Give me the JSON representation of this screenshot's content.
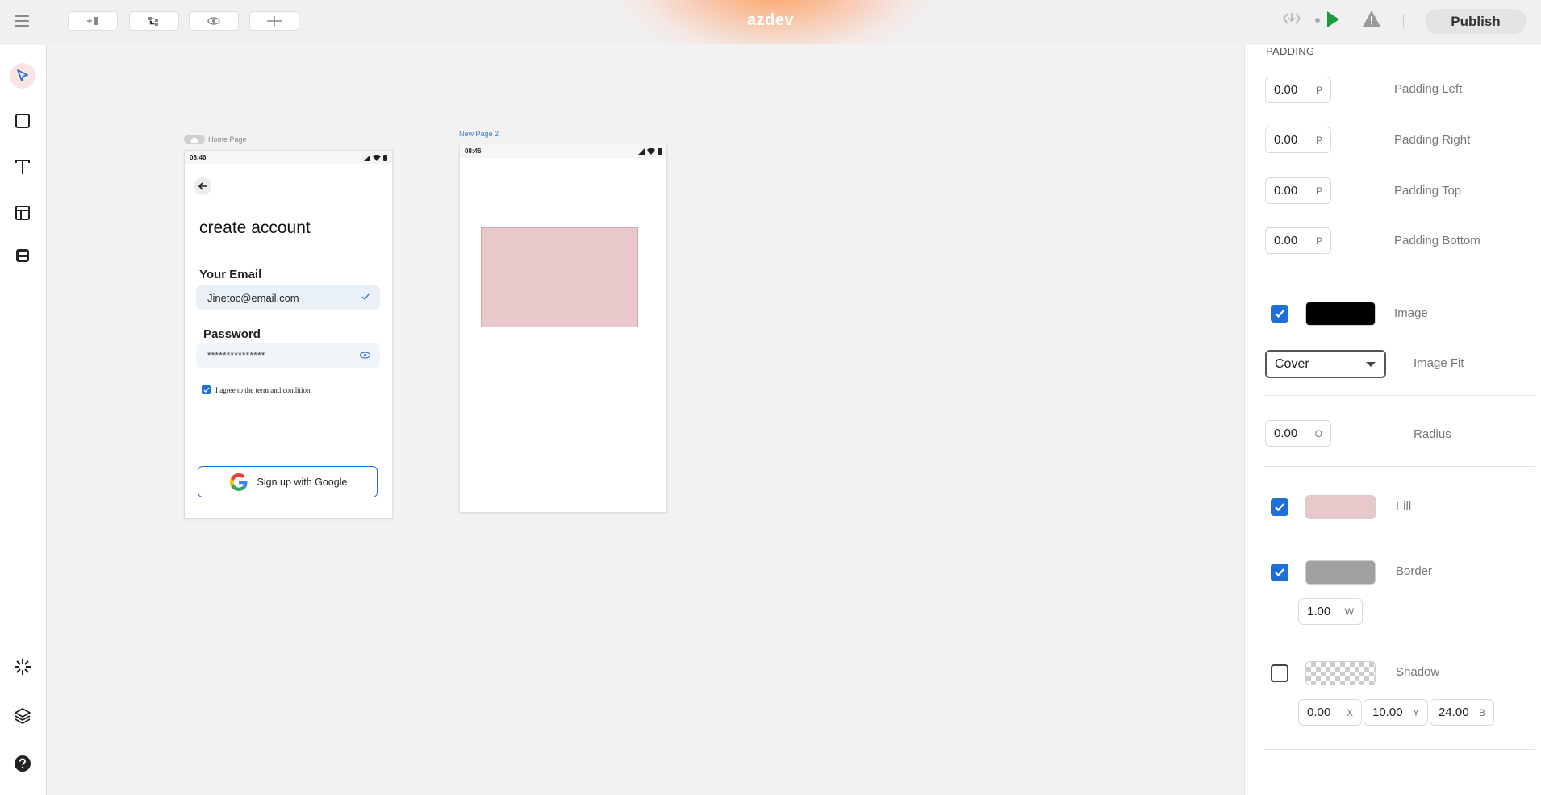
{
  "app": {
    "brand": "azdev",
    "publish_label": "Publish"
  },
  "canvas": {
    "frames": [
      {
        "label": "Home Page",
        "status_time": "08:46",
        "title": "create account",
        "email_label": "Your Email",
        "email_value": "Jinetoc@email.com",
        "password_label": "Password",
        "password_value": "***************",
        "agree_text": "I agree to the term and condition.",
        "google_button": "Sign up with Google"
      },
      {
        "label": "New Page 2",
        "status_time": "08:46"
      }
    ]
  },
  "panel": {
    "padding": {
      "section_title": "PADDING",
      "left": {
        "value": "0.00",
        "unit": "P",
        "label": "Padding Left"
      },
      "right": {
        "value": "0.00",
        "unit": "P",
        "label": "Padding Right"
      },
      "top": {
        "value": "0.00",
        "unit": "P",
        "label": "Padding Top"
      },
      "bottom": {
        "value": "0.00",
        "unit": "P",
        "label": "Padding Bottom"
      }
    },
    "image": {
      "label": "Image",
      "checked": true,
      "color": "#000000"
    },
    "image_fit": {
      "label": "Image Fit",
      "value": "Cover"
    },
    "radius": {
      "value": "0.00",
      "unit": "O",
      "label": "Radius"
    },
    "fill": {
      "label": "Fill",
      "checked": true,
      "color": "#e8c8ca"
    },
    "border": {
      "label": "Border",
      "checked": true,
      "color": "#a0a0a0",
      "width": "1.00",
      "width_unit": "W"
    },
    "shadow": {
      "label": "Shadow",
      "checked": false,
      "x": "0.00",
      "x_unit": "X",
      "y": "10.00",
      "y_unit": "Y",
      "b": "24.00",
      "b_unit": "B"
    }
  },
  "colors": {
    "accent": "#1e6fd9",
    "play": "#1e9a3c",
    "active_tool_bg": "#fde4e4"
  },
  "icons": {
    "toolbar": [
      "add-component-icon",
      "hierarchy-icon",
      "eye-icon",
      "plus-icon"
    ],
    "left_tools": [
      "pointer-icon",
      "rectangle-icon",
      "text-icon",
      "layout-icon",
      "save-icon",
      "sparkle-icon",
      "layers-icon",
      "help-icon"
    ],
    "top_right": [
      "code-icon",
      "dot-icon",
      "play-icon",
      "warning-icon"
    ]
  }
}
